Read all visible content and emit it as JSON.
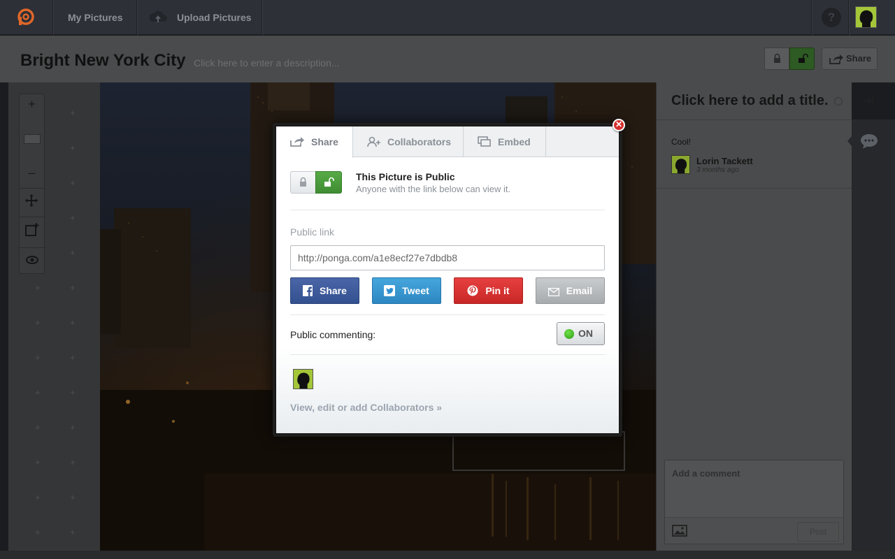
{
  "nav": {
    "my_pictures": "My Pictures",
    "upload_pictures": "Upload Pictures",
    "help": "?"
  },
  "picture": {
    "title": "Bright New York City",
    "description_placeholder": "Click here to enter a description...",
    "share_label": "Share"
  },
  "panel": {
    "title_placeholder": "Click here to add a title.",
    "comment": {
      "text": "Cool!",
      "author": "Lorin Tackett",
      "time": "3 months ago"
    },
    "add_comment_placeholder": "Add a comment",
    "post_label": "Post"
  },
  "modal": {
    "tabs": [
      {
        "label": "Share"
      },
      {
        "label": "Collaborators"
      },
      {
        "label": "Embed"
      }
    ],
    "privacy_title": "This Picture is Public",
    "privacy_subtitle": "Anyone with the link below can view it.",
    "public_link_label": "Public link",
    "public_link_value": "http://ponga.com/a1e8ecf27e7dbdb8",
    "buttons": {
      "facebook": "Share",
      "twitter": "Tweet",
      "pinterest": "Pin it",
      "email": "Email"
    },
    "commenting_label": "Public commenting:",
    "commenting_state": "ON",
    "collaborators_link": "View, edit or add Collaborators »",
    "close_glyph": "✕"
  },
  "tools": {
    "zoom_in": "+",
    "zoom_out": "–"
  },
  "colors": {
    "accent_green": "#4a9d3c",
    "facebook": "#3b5998",
    "twitter": "#2d8ed0",
    "pinterest": "#d22f2f",
    "email": "#b4b7ba",
    "close_red": "#d5302e"
  }
}
